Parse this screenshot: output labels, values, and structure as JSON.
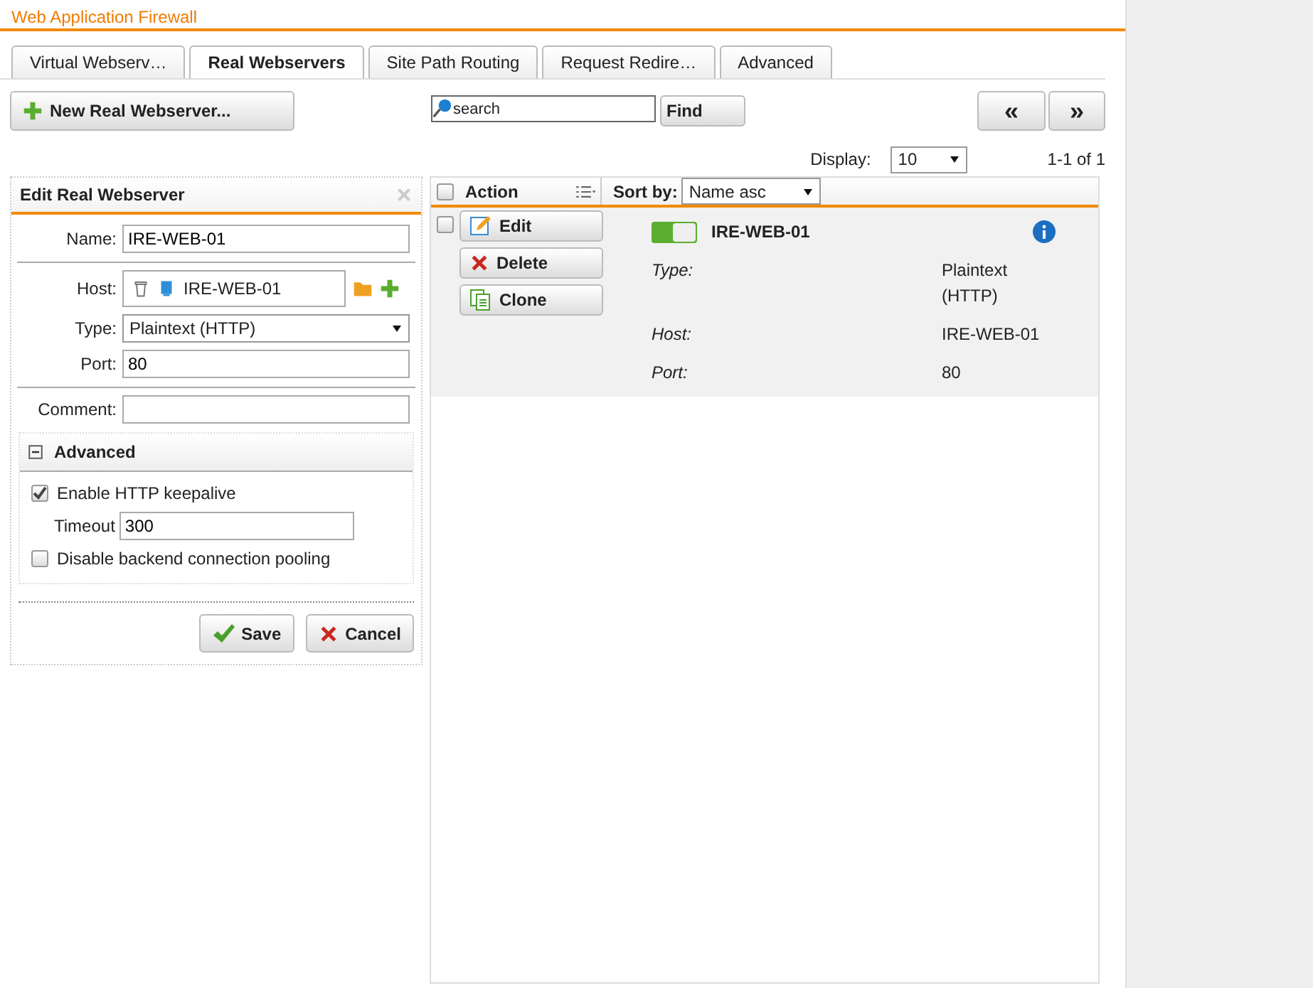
{
  "header": {
    "title": "Web Application Firewall"
  },
  "tabs": [
    {
      "label": "Virtual Webserv…",
      "selected": false
    },
    {
      "label": "Real Webservers",
      "selected": true
    },
    {
      "label": "Site Path Routing",
      "selected": false
    },
    {
      "label": "Request Redire…",
      "selected": false
    },
    {
      "label": "Advanced",
      "selected": false
    }
  ],
  "toolbar": {
    "new_button": "New Real Webserver...",
    "search": {
      "placeholder": "search"
    },
    "find_button": "Find",
    "prev_button": "«",
    "next_button": "»"
  },
  "pagination": {
    "display_label": "Display:",
    "display_value": "10",
    "range": "1-1 of 1"
  },
  "edit_panel": {
    "title": "Edit Real Webserver",
    "fields": [
      {
        "kind": "text",
        "label": "Name:",
        "value": "IRE-WEB-01"
      },
      {
        "kind": "divider"
      },
      {
        "kind": "host",
        "label": "Host:",
        "value": "IRE-WEB-01"
      },
      {
        "kind": "select",
        "label": "Type:",
        "value": "Plaintext (HTTP)"
      },
      {
        "kind": "text",
        "label": "Port:",
        "value": "80"
      },
      {
        "kind": "divider"
      },
      {
        "kind": "text",
        "label": "Comment:"
      }
    ],
    "advanced": {
      "title": "Advanced",
      "expanded": true,
      "options": [
        {
          "kind": "checkbox",
          "label": "Enable HTTP keepalive",
          "checked": true
        },
        {
          "kind": "number",
          "label": "Timeout",
          "value": "300"
        },
        {
          "kind": "checkbox",
          "label": "Disable backend connection pooling",
          "checked": false
        }
      ]
    },
    "buttons": [
      {
        "kind": "save",
        "label": "Save"
      },
      {
        "kind": "cancel",
        "label": "Cancel"
      }
    ]
  },
  "list": {
    "action_header": "Action",
    "select_all_checked": false,
    "sort_label": "Sort by:",
    "sort_value": "Name asc",
    "items": [
      {
        "name": "IRE-WEB-01",
        "enabled": true,
        "checked": false,
        "actions": [
          {
            "kind": "edit",
            "label": "Edit"
          },
          {
            "kind": "delete",
            "label": "Delete"
          },
          {
            "kind": "clone",
            "label": "Clone"
          }
        ],
        "properties": [
          {
            "label": "Type:",
            "value": "Plaintext (HTTP)"
          },
          {
            "label": "Host:",
            "value": "IRE-WEB-01"
          },
          {
            "label": "Port:",
            "value": "80"
          }
        ]
      }
    ]
  }
}
